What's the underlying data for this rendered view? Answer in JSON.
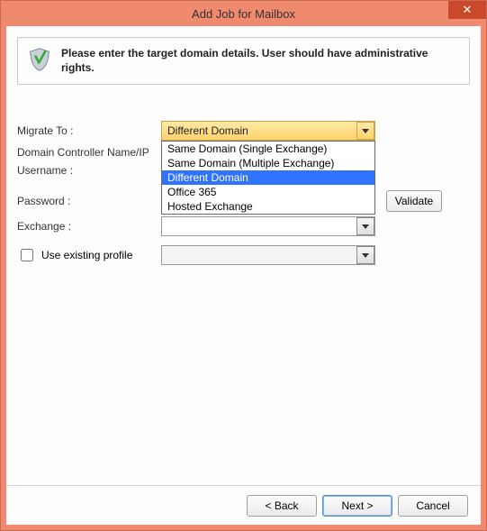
{
  "window": {
    "title": "Add Job for Mailbox"
  },
  "header": {
    "text": "Please enter the target domain details. User should have administrative rights."
  },
  "form": {
    "migrate_to_label": "Migrate To :",
    "migrate_to_value": "Different Domain",
    "migrate_to_options": [
      "Same Domain (Single Exchange)",
      "Same Domain (Multiple Exchange)",
      "Different Domain",
      "Office 365",
      "Hosted Exchange"
    ],
    "migrate_to_highlight_index": 2,
    "domain_controller_label": "Domain Controller Name/IP",
    "domain_controller_value": "",
    "username_label": "Username :",
    "username_value": "",
    "password_label": "Password :",
    "password_value": "",
    "validate_label": "Validate",
    "exchange_label": "Exchange :",
    "exchange_value": "",
    "use_existing_label": "Use existing profile",
    "use_existing_checked": false,
    "profile_value": ""
  },
  "footer": {
    "back": "< Back",
    "next": "Next >",
    "cancel": "Cancel"
  }
}
